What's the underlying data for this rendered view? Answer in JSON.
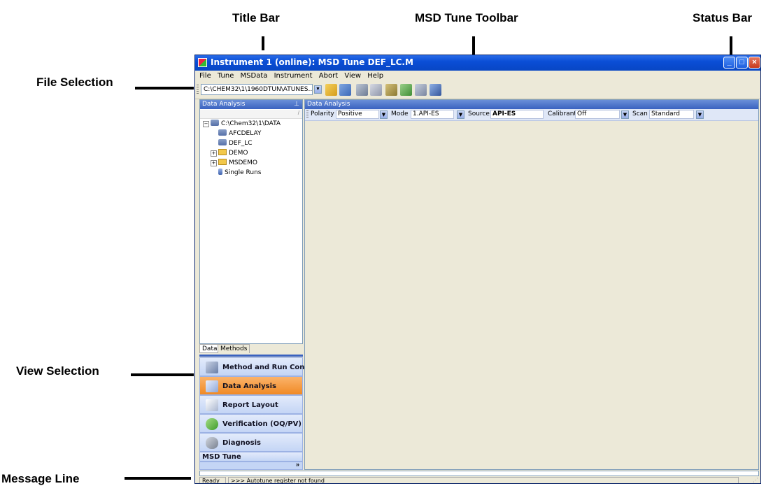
{
  "callouts": {
    "title_bar": "Title Bar",
    "toolbar": "MSD Tune Toolbar",
    "status_bar": "Status Bar",
    "file_selection": "File Selection",
    "view_selection": "View Selection",
    "message_line": "Message Line"
  },
  "window": {
    "title": "Instrument 1 (online): MSD Tune DEF_LC.M",
    "controls": [
      "minimize-icon",
      "maximize-icon",
      "close-icon"
    ]
  },
  "menu": [
    "File",
    "Tune",
    "MSData",
    "Instrument",
    "Abort",
    "View",
    "Help"
  ],
  "toolbar": {
    "file_path": "C:\\CHEM32\\1\\1960DTUN\\ATUNES...",
    "icons": [
      "open-folder-icon",
      "save-icon",
      "print-icon",
      "tune-icon",
      "chart-icon",
      "report-icon",
      "table-icon",
      "disk-icon"
    ]
  },
  "left_panel": {
    "header": "Data Analysis",
    "pin_icon": "pin-icon",
    "tree": {
      "root": "C:\\Chem32\\1\\DATA",
      "items": [
        "AFCDELAY",
        "DEF_LC",
        "DEMO",
        "MSDEMO",
        "Single Runs"
      ]
    },
    "tabs": [
      "Data",
      "Methods"
    ]
  },
  "views": [
    {
      "label": "Method and Run Control",
      "icon": "method-run-icon",
      "active": false
    },
    {
      "label": "Data Analysis",
      "icon": "data-analysis-icon",
      "active": true
    },
    {
      "label": "Report Layout",
      "icon": "report-layout-icon",
      "active": false
    },
    {
      "label": "Verification (OQ/PV)",
      "icon": "verification-icon",
      "active": false
    },
    {
      "label": "Diagnosis",
      "icon": "diagnosis-icon",
      "active": false
    },
    {
      "label": "MSD Tune",
      "icon": "",
      "active": false
    }
  ],
  "right_panel": {
    "header": "Data Analysis",
    "params": {
      "polarity_label": "Polarity",
      "polarity_value": "Positive",
      "mode_label": "Mode",
      "mode_value": "1.API-ES",
      "source_label": "Source",
      "source_value": "API-ES",
      "calibrant_label": "Calibrant",
      "calibrant_value": "Off",
      "scan_label": "Scan",
      "scan_value": "Standard"
    }
  },
  "status": {
    "state": "Ready",
    "message": ">>> Autotune register not found"
  },
  "colors": {
    "title_blue": "#0a4ed6",
    "active_view": "#f08a25",
    "nav_bg": "#c4d5f5",
    "workspace": "#ece9d8"
  }
}
